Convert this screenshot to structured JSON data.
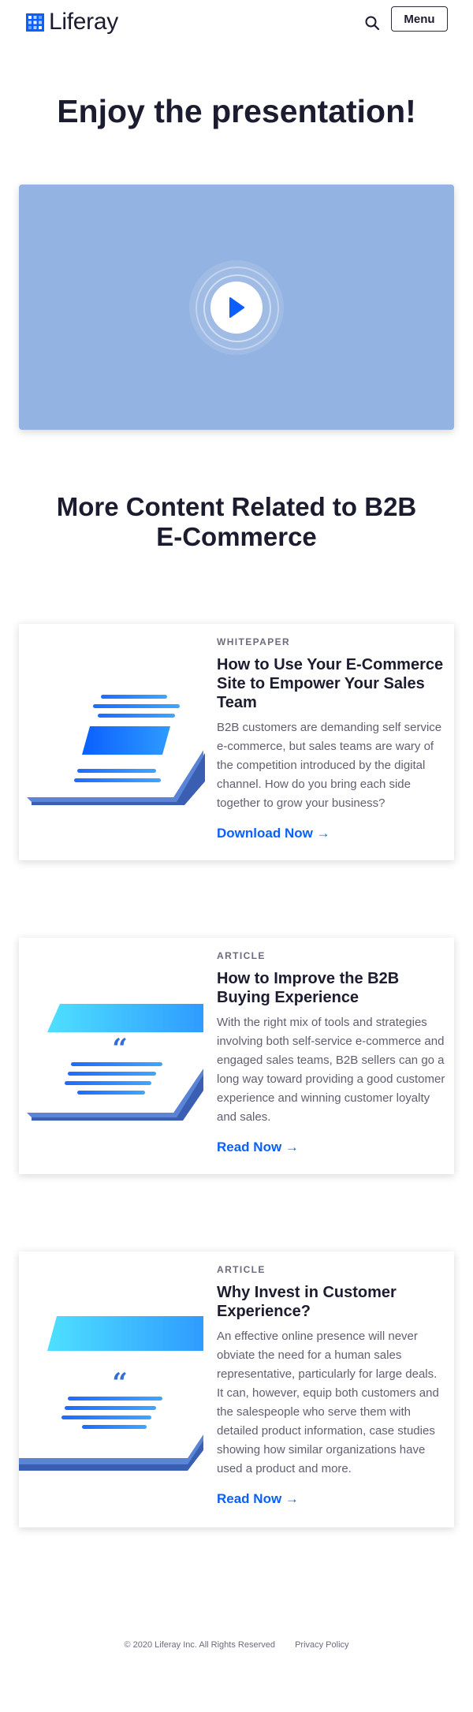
{
  "brand": {
    "name": "Liferay"
  },
  "header": {
    "menu_label": "Menu",
    "search_icon": "search-icon"
  },
  "hero": {
    "title": "Enjoy the presentation!"
  },
  "video": {
    "play_icon": "play-icon",
    "background": "#93b3e2",
    "accent": "#0b5fff"
  },
  "related": {
    "title": "More Content Related to B2B E-Commerce",
    "cards": [
      {
        "category": "WHITEPAPER",
        "title": "How to Use Your E-Commerce Site to Empower Your Sales Team",
        "description": "B2B customers are demanding self service e-commerce, but sales teams are wary of the competition introduced by the digital channel.  How do you bring each side together to grow your business?",
        "link": "Download Now →",
        "illustration": "document-illustration"
      },
      {
        "category": "ARTICLE",
        "title": "How to Improve the B2B Buying Experience",
        "description": "With the right mix of tools and strategies involving both self-service e-commerce and engaged sales teams, B2B sellers can go a long way toward providing a good customer experience and winning customer loyalty and sales.",
        "link": "Read Now →",
        "illustration": "quote-article-illustration"
      },
      {
        "category": "ARTICLE",
        "title": "Why Invest in Customer Experience?",
        "description": "An effective online presence will never obviate the need for a human sales representative, particularly for large deals. It can, however, equip both customers and the salespeople who serve them with detailed product information, case studies showing how similar organizations have used a product and more.",
        "link": "Read Now →",
        "illustration": "quote-article-illustration"
      }
    ]
  },
  "footer": {
    "copyright": "© 2020 Liferay Inc. All Rights Reserved",
    "privacy": "Privacy Policy"
  },
  "colors": {
    "link": "#0b5fff",
    "text": "#1c1c30",
    "muted": "#6b6c7e"
  }
}
